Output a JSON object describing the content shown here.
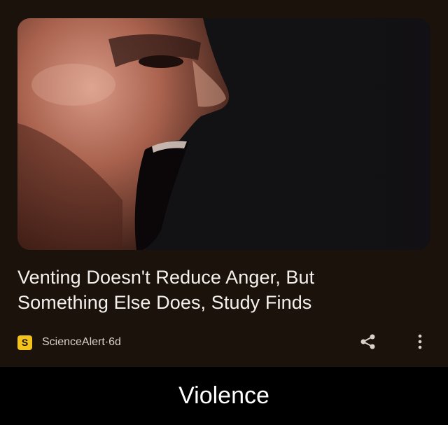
{
  "card": {
    "image_icon": "screaming-man-photo",
    "headline": "Venting Doesn't Reduce Anger, But Something Else Does, Study Finds",
    "source": {
      "logo_letter": "S",
      "name": "ScienceAlert",
      "separator": " · ",
      "age": "6d",
      "logo_color": "#f3c21b"
    },
    "share_icon": "share-icon",
    "more_icon": "more-vertical-icon"
  },
  "caption": "Violence"
}
